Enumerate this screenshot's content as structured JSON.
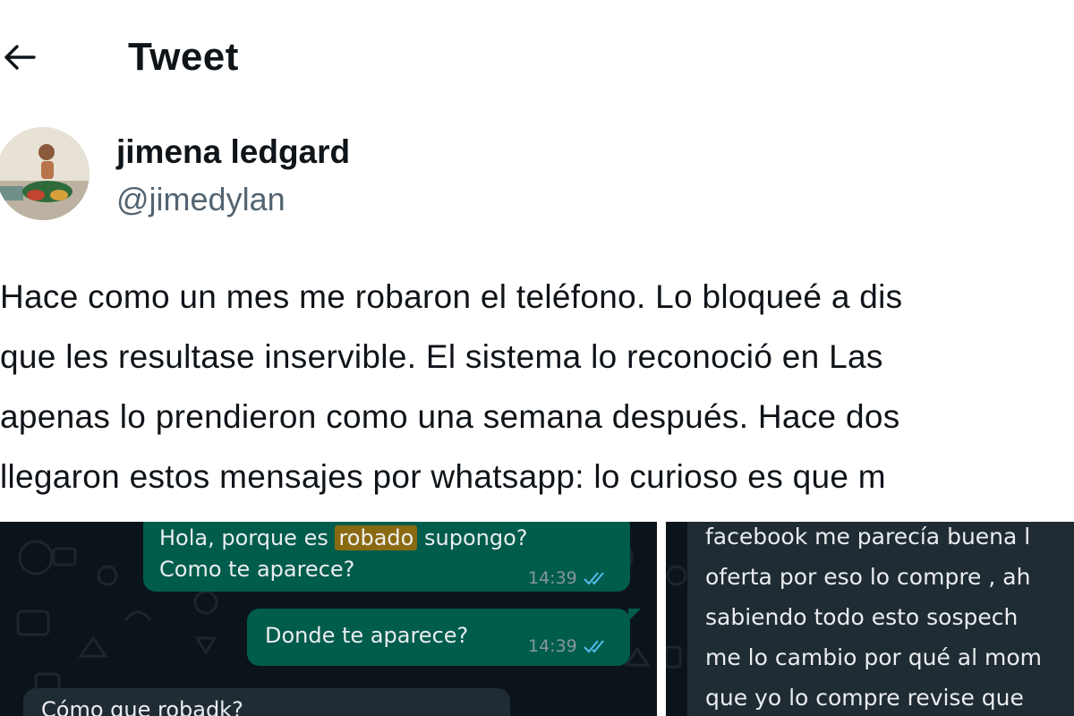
{
  "header": {
    "title": "Tweet",
    "back_icon": "arrow-left-icon"
  },
  "author": {
    "display_name": "jimena ledgard",
    "handle": "@jimedylan",
    "avatar_icon": "avatar-photo"
  },
  "tweet": {
    "lines": [
      "Hace como un mes me robaron el teléfono. Lo bloqueé a dis",
      "que les resultase inservible.  El sistema lo reconoció en Las",
      "apenas lo prendieron como una semana después. Hace dos",
      "llegaron estos mensajes por whatsapp: lo curioso es que m"
    ]
  },
  "media": {
    "left_chat": {
      "msg1_before": "Hola, porque es ",
      "msg1_highlight": "robado",
      "msg1_after": " supongo?",
      "msg1_line2": "Como te aparece?",
      "msg1_time": "14:39",
      "msg2_text": "Donde te aparece?",
      "msg2_time": "14:39",
      "msg3_text": "Cómo que robadk?",
      "read_receipt_icon": "double-check-icon",
      "receipt_color": "#53bdeb"
    },
    "right_chat": {
      "lines": [
        "facebook me parecía buena l",
        "oferta por eso lo compre , ah",
        "sabiendo todo esto sospech",
        "me lo cambio por qué al mom",
        "que yo lo compre revise que"
      ]
    }
  },
  "colors": {
    "text_primary": "#0f1419",
    "text_secondary": "#536471",
    "chat_background": "#0b141a",
    "outgoing_bubble": "#005c4b",
    "incoming_bubble": "#202c33"
  }
}
